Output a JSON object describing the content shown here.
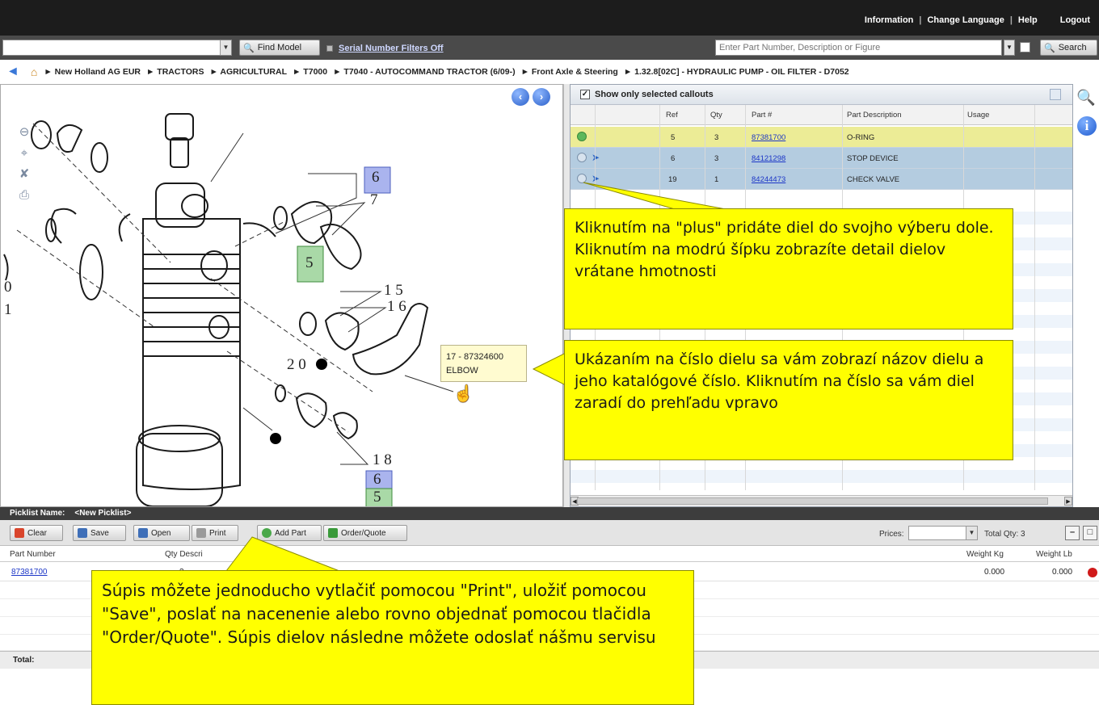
{
  "topnav": {
    "information": "Information",
    "change_language": "Change Language",
    "help": "Help",
    "logout": "Logout",
    "separator": "|"
  },
  "search_row": {
    "find_model": "Find Model",
    "serial_filters": "Serial Number Filters Off",
    "part_search_placeholder": "Enter Part Number, Description or Figure",
    "search": "Search"
  },
  "breadcrumb": [
    "► New Holland AG EUR",
    "► TRACTORS",
    "► AGRICULTURAL",
    "► T7000",
    "► T7040 - AUTOCOMMAND TRACTOR (6/09-)",
    "► Front Axle & Steering",
    "► 1.32.8[02C] - HYDRAULIC PUMP - OIL FILTER - D7052"
  ],
  "drawing": {
    "callout_labels": {
      "c6_top": "6",
      "c7": "7",
      "c5": "5",
      "c15": "1 5",
      "c16": "1 6",
      "c20": "2 0",
      "c18": "1 8",
      "c6_bottom": "6",
      "c5_bottom": "5",
      "c0": "0",
      "c1": "1"
    },
    "tooltip": {
      "line1": "17 - 87324600",
      "line2": "ELBOW"
    },
    "nav_prev": "‹",
    "nav_next": "›"
  },
  "parts_table": {
    "show_selected": "Show only selected callouts",
    "columns": {
      "ref": "Ref",
      "qty": "Qty",
      "part_no": "Part #",
      "description": "Part Description",
      "usage": "Usage"
    },
    "rows": [
      {
        "ref": "5",
        "qty": "3",
        "part_no": "87381700",
        "description": "O-RING",
        "usage": ""
      },
      {
        "ref": "6",
        "qty": "3",
        "part_no": "84121298",
        "description": "STOP DEVICE",
        "usage": ""
      },
      {
        "ref": "19",
        "qty": "1",
        "part_no": "84244473",
        "description": "CHECK VALVE",
        "usage": ""
      }
    ]
  },
  "picklist": {
    "name_label": "Picklist Name:",
    "name_value": "<New Picklist>",
    "buttons": {
      "clear": "Clear",
      "save": "Save",
      "open": "Open",
      "print": "Print",
      "add_part": "Add Part",
      "order_quote": "Order/Quote"
    },
    "prices_label": "Prices:",
    "total_qty": "Total Qty: 3",
    "minimize": "–",
    "maximize": "□",
    "columns": {
      "part_number": "Part Number",
      "qty_desc": "Qty Descri",
      "weight_kg": "Weight Kg",
      "weight_lb": "Weight Lb"
    },
    "row": {
      "part_number": "87381700",
      "qty": "3",
      "weight_kg": "0.000",
      "weight_lb": "0.000"
    },
    "total": "Total:"
  },
  "notes": {
    "note1": "Kliknutím na \"plus\" pridáte diel do svojho výberu dole. Kliknutím na modrú šípku zobrazíte detail dielov vrátane hmotnosti",
    "note2": "Ukázaním na číslo dielu sa vám zobrazí názov dielu a jeho katalógové číslo. Kliknutím na číslo sa vám diel zaradí do prehľadu vpravo",
    "note3": "Súpis môžete jednoducho vytlačiť pomocou \"Print\", uložiť pomocou \"Save\", poslať na nacenenie alebo rovno objednať pomocou tlačidla \"Order/Quote\". Súpis dielov následne môžete odoslať nášmu servisu"
  },
  "colors": {
    "note_yellow": "#ffff00",
    "selected_row": "#ecec96",
    "row_blue": "#b4cce0",
    "link_blue": "#1c36c7"
  }
}
